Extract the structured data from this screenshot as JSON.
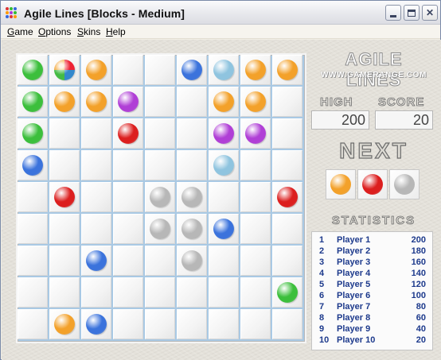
{
  "window": {
    "title": "Agile Lines   [Blocks  -  Medium]",
    "icon": "app-grid-icon",
    "controls": {
      "minimize": "minimize-icon",
      "maximize": "maximize-icon",
      "close": "close-icon",
      "close_glyph": "✕"
    }
  },
  "menu": [
    {
      "label_u": "G",
      "label_rest": "ame"
    },
    {
      "label_u": "O",
      "label_rest": "ptions"
    },
    {
      "label_u": "S",
      "label_rest": "kins"
    },
    {
      "label_u": "H",
      "label_rest": "elp"
    }
  ],
  "colors": {
    "green": "#3cbf3c",
    "orange": "#f3a12a",
    "blue": "#3b73dc",
    "lightblue": "#8fc4df",
    "purple": "#b03fd6",
    "red": "#dc1f1f",
    "gray": "#b7b7b7"
  },
  "board": {
    "rows": 9,
    "cols": 9,
    "balls": [
      {
        "row": 0,
        "col": 0,
        "color": "green"
      },
      {
        "row": 0,
        "col": 1,
        "color": "rainbow"
      },
      {
        "row": 0,
        "col": 2,
        "color": "orange"
      },
      {
        "row": 0,
        "col": 5,
        "color": "blue"
      },
      {
        "row": 0,
        "col": 6,
        "color": "lightblue"
      },
      {
        "row": 0,
        "col": 7,
        "color": "orange"
      },
      {
        "row": 0,
        "col": 8,
        "color": "orange"
      },
      {
        "row": 1,
        "col": 0,
        "color": "green"
      },
      {
        "row": 1,
        "col": 1,
        "color": "orange"
      },
      {
        "row": 1,
        "col": 2,
        "color": "orange"
      },
      {
        "row": 1,
        "col": 3,
        "color": "purple"
      },
      {
        "row": 1,
        "col": 6,
        "color": "orange"
      },
      {
        "row": 1,
        "col": 7,
        "color": "orange"
      },
      {
        "row": 2,
        "col": 0,
        "color": "green"
      },
      {
        "row": 2,
        "col": 3,
        "color": "red"
      },
      {
        "row": 2,
        "col": 6,
        "color": "purple"
      },
      {
        "row": 2,
        "col": 7,
        "color": "purple"
      },
      {
        "row": 3,
        "col": 0,
        "color": "blue"
      },
      {
        "row": 3,
        "col": 6,
        "color": "lightblue"
      },
      {
        "row": 4,
        "col": 1,
        "color": "red"
      },
      {
        "row": 4,
        "col": 4,
        "color": "gray"
      },
      {
        "row": 4,
        "col": 5,
        "color": "gray"
      },
      {
        "row": 4,
        "col": 8,
        "color": "red"
      },
      {
        "row": 5,
        "col": 4,
        "color": "gray"
      },
      {
        "row": 5,
        "col": 5,
        "color": "gray"
      },
      {
        "row": 5,
        "col": 6,
        "color": "blue"
      },
      {
        "row": 6,
        "col": 2,
        "color": "blue"
      },
      {
        "row": 6,
        "col": 5,
        "color": "gray"
      },
      {
        "row": 7,
        "col": 8,
        "color": "green"
      },
      {
        "row": 8,
        "col": 1,
        "color": "orange"
      },
      {
        "row": 8,
        "col": 2,
        "color": "blue"
      }
    ]
  },
  "logo": {
    "title": "AGILE LINES",
    "subtitle": "WWW.GAMERANGE.COM"
  },
  "scoreboard": {
    "high_label": "HIGH",
    "score_label": "SCORE",
    "high_value": "200",
    "score_value": "20"
  },
  "next": {
    "title": "NEXT",
    "balls": [
      "orange",
      "red",
      "gray"
    ]
  },
  "statistics": {
    "title": "STATISTICS",
    "rows": [
      {
        "rank": "1",
        "name": "Player 1",
        "score": "200"
      },
      {
        "rank": "2",
        "name": "Player 2",
        "score": "180"
      },
      {
        "rank": "3",
        "name": "Player 3",
        "score": "160"
      },
      {
        "rank": "4",
        "name": "Player 4",
        "score": "140"
      },
      {
        "rank": "5",
        "name": "Player 5",
        "score": "120"
      },
      {
        "rank": "6",
        "name": "Player 6",
        "score": "100"
      },
      {
        "rank": "7",
        "name": "Player 7",
        "score": "80"
      },
      {
        "rank": "8",
        "name": "Player 8",
        "score": "60"
      },
      {
        "rank": "9",
        "name": "Player 9",
        "score": "40"
      },
      {
        "rank": "10",
        "name": "Player 10",
        "score": "20"
      }
    ]
  }
}
